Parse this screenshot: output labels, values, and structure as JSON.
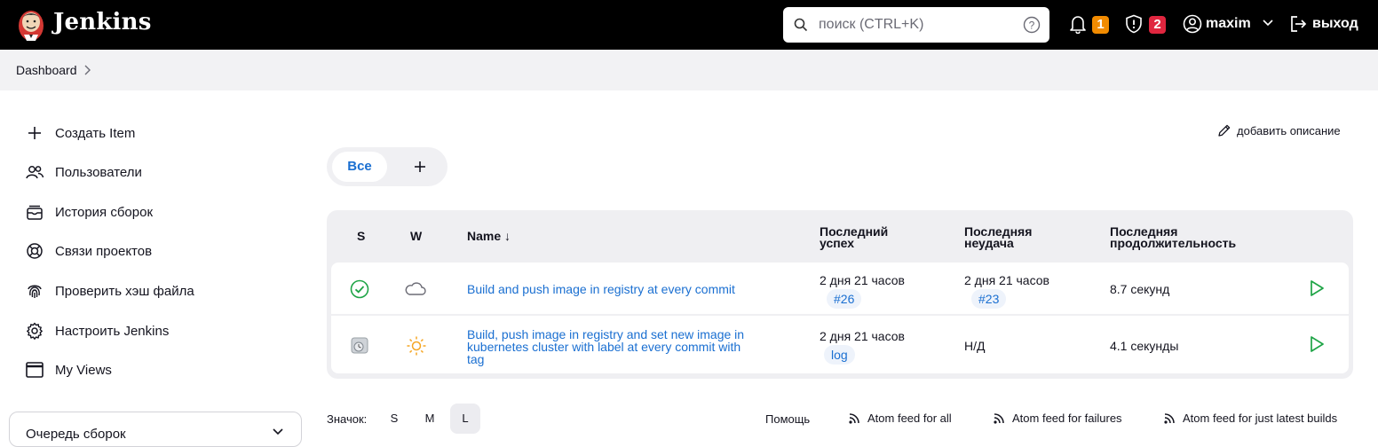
{
  "header": {
    "brand": "Jenkins",
    "search_placeholder": "поиск (CTRL+K)",
    "notifications_count": "1",
    "security_count": "2",
    "user": "maxim",
    "logout": "выход",
    "colors": {
      "notif_badge": "#f28b00",
      "security_badge": "#e0263f"
    }
  },
  "breadcrumb": {
    "dashboard": "Dashboard"
  },
  "sidebar": {
    "items": [
      {
        "label": "Создать Item",
        "icon": "plus-icon"
      },
      {
        "label": "Пользователи",
        "icon": "users-icon"
      },
      {
        "label": "История сборок",
        "icon": "history-icon"
      },
      {
        "label": "Связи проектов",
        "icon": "relations-icon"
      },
      {
        "label": "Проверить хэш файла",
        "icon": "fingerprint-icon"
      },
      {
        "label": "Настроить Jenkins",
        "icon": "gear-icon"
      },
      {
        "label": "My Views",
        "icon": "window-icon"
      }
    ],
    "queue_label": "Очередь сборок"
  },
  "main": {
    "add_description": "добавить описание",
    "tabs": {
      "all": "Все"
    },
    "table": {
      "headers": {
        "s": "S",
        "w": "W",
        "name": "Name ↓",
        "last_success_1": "Последний",
        "last_success_2": "успех",
        "last_failure_1": "Последняя",
        "last_failure_2": "неудача",
        "last_duration_1": "Последняя",
        "last_duration_2": "продолжительность"
      },
      "rows": [
        {
          "status": "success-icon",
          "weather": "cloudy-icon",
          "name": "Build and push image in registry at every commit",
          "last_success": "2 дня 21 часов",
          "last_success_build": "#26",
          "last_failure": "2 дня 21 часов",
          "last_failure_build": "#23",
          "last_duration": "8.7 секунд"
        },
        {
          "status": "not-built-icon",
          "weather": "sunny-icon",
          "name_1": "Build, push image in registry and set new image in",
          "name_2": "kubernetes cluster with label at every commit with",
          "name_3": "tag",
          "last_success": "2 дня 21 часов",
          "last_success_build": "log",
          "last_failure": "Н/Д",
          "last_duration": "4.1 секунды"
        }
      ]
    }
  },
  "footer": {
    "icon_label": "Значок:",
    "sizes": [
      "S",
      "M",
      "L"
    ],
    "selected_size": "L",
    "help": "Помощь",
    "feed_all": "Atom feed for all",
    "feed_failures": "Atom feed for failures",
    "feed_latest": "Atom feed for just latest builds"
  }
}
